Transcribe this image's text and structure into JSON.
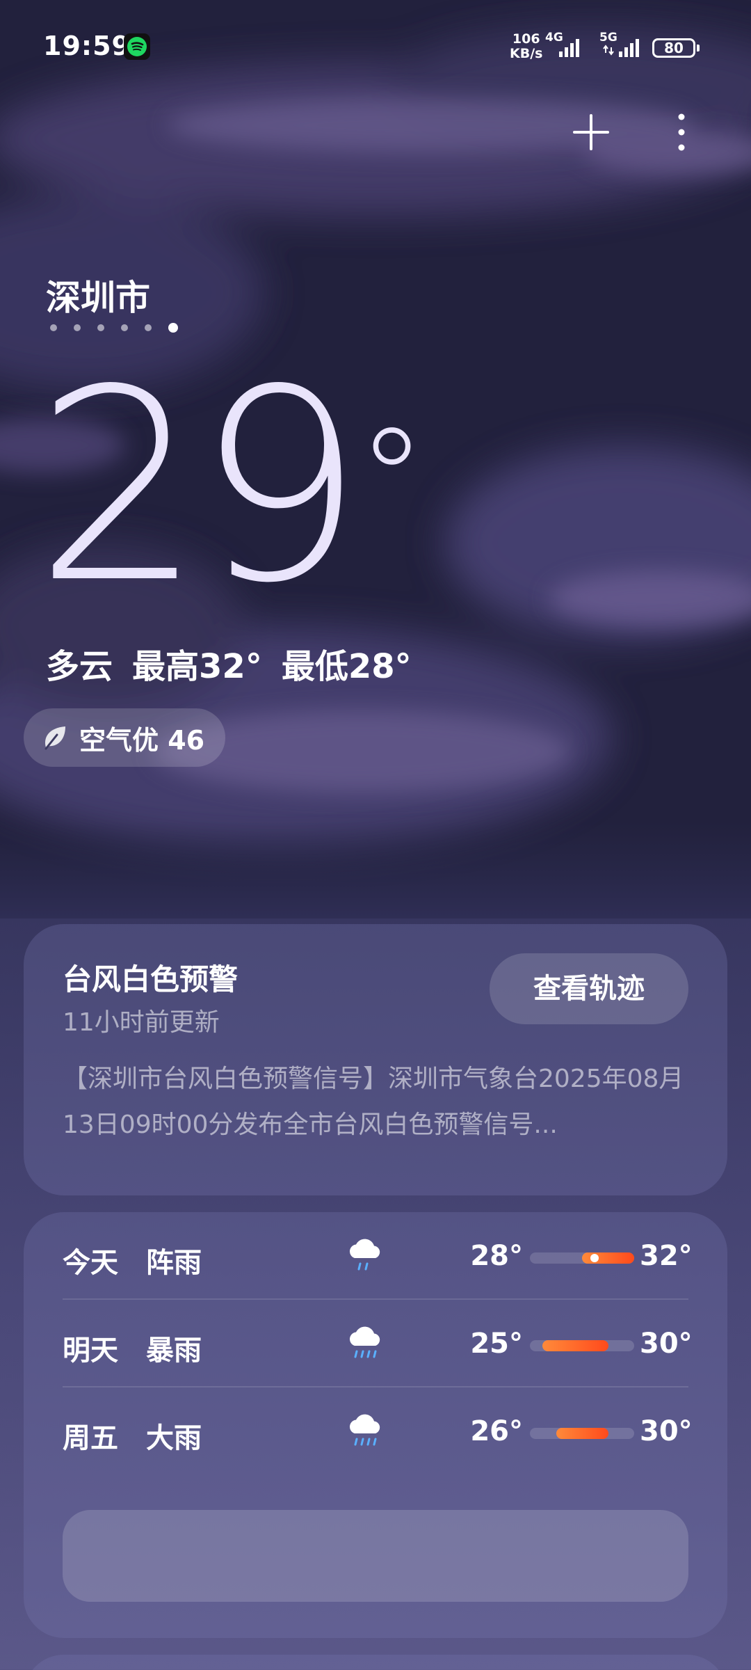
{
  "status_bar": {
    "time": "19:59",
    "net_speed_value": "106",
    "net_speed_unit": "KB/s",
    "sig1_label": "4G",
    "sig2_label": "5G",
    "battery": "80"
  },
  "location": {
    "city": "深圳市",
    "page_count": 6,
    "active_page": 6
  },
  "current": {
    "temperature": "29",
    "degree_symbol": "°",
    "condition": "多云",
    "high": "最高32°",
    "low": "最低28°",
    "aqi": "空气优 46"
  },
  "warning": {
    "title": "台风白色预警",
    "updated": "11小时前更新",
    "button": "查看轨迹",
    "body": "【深圳市台风白色预警信号】深圳市气象台2025年08月13日09时00分发布全市台风白色预警信号..."
  },
  "forecast": [
    {
      "day": "今天",
      "condition": "阵雨",
      "icon": "light-rain-icon",
      "low": "28°",
      "high": "32°",
      "bar_start": 0.5,
      "bar_end": 1.0,
      "now": 0.62
    },
    {
      "day": "明天",
      "condition": "暴雨",
      "icon": "heavy-rain-icon",
      "low": "25°",
      "high": "30°",
      "bar_start": 0.12,
      "bar_end": 0.75
    },
    {
      "day": "周五",
      "condition": "大雨",
      "icon": "heavy-rain-icon",
      "low": "26°",
      "high": "30°",
      "bar_start": 0.25,
      "bar_end": 0.75
    }
  ],
  "colors": {
    "bar_fill_start": "#ff8a3a",
    "bar_fill_end": "#ff4a1c",
    "temp_text": "#e9e4fb"
  }
}
